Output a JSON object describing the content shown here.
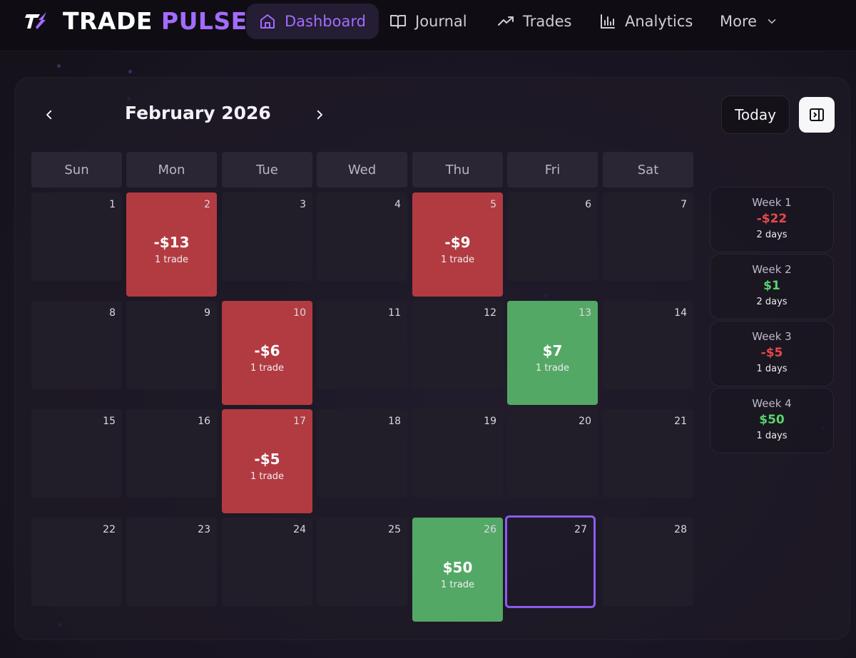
{
  "brand": {
    "word1": "TRADE",
    "word2": "PULSE"
  },
  "nav": {
    "items": [
      {
        "label": "Dashboard",
        "icon": "home-icon",
        "active": true
      },
      {
        "label": "Journal",
        "icon": "book-icon",
        "active": false
      },
      {
        "label": "Trades",
        "icon": "trending-up-icon",
        "active": false
      },
      {
        "label": "Analytics",
        "icon": "bar-chart-icon",
        "active": false
      },
      {
        "label": "More",
        "icon": "chevron-down-icon",
        "active": false
      }
    ]
  },
  "calendar": {
    "month_label": "February 2026",
    "today_label": "Today",
    "weekdays": [
      "Sun",
      "Mon",
      "Tue",
      "Wed",
      "Thu",
      "Fri",
      "Sat"
    ],
    "days": [
      {
        "num": "1"
      },
      {
        "num": "2",
        "pnl": "-$13",
        "trades": "1 trade",
        "status": "loss"
      },
      {
        "num": "3"
      },
      {
        "num": "4"
      },
      {
        "num": "5",
        "pnl": "-$9",
        "trades": "1 trade",
        "status": "loss"
      },
      {
        "num": "6"
      },
      {
        "num": "7"
      },
      {
        "num": "8"
      },
      {
        "num": "9"
      },
      {
        "num": "10",
        "pnl": "-$6",
        "trades": "1 trade",
        "status": "loss"
      },
      {
        "num": "11"
      },
      {
        "num": "12"
      },
      {
        "num": "13",
        "pnl": "$7",
        "trades": "1 trade",
        "status": "win"
      },
      {
        "num": "14"
      },
      {
        "num": "15"
      },
      {
        "num": "16"
      },
      {
        "num": "17",
        "pnl": "-$5",
        "trades": "1 trade",
        "status": "loss"
      },
      {
        "num": "18"
      },
      {
        "num": "19"
      },
      {
        "num": "20"
      },
      {
        "num": "21"
      },
      {
        "num": "22"
      },
      {
        "num": "23"
      },
      {
        "num": "24"
      },
      {
        "num": "25"
      },
      {
        "num": "26",
        "pnl": "$50",
        "trades": "1 trade",
        "status": "win"
      },
      {
        "num": "27",
        "status": "today"
      },
      {
        "num": "28"
      }
    ]
  },
  "weeks": [
    {
      "label": "Week 1",
      "value": "-$22",
      "days": "2 days",
      "sign": "neg"
    },
    {
      "label": "Week 2",
      "value": "$1",
      "days": "2 days",
      "sign": "pos"
    },
    {
      "label": "Week 3",
      "value": "-$5",
      "days": "1 days",
      "sign": "neg"
    },
    {
      "label": "Week 4",
      "value": "$50",
      "days": "1 days",
      "sign": "pos"
    }
  ],
  "colors": {
    "accent": "#a36bff",
    "loss": "#b23b41",
    "win": "#54a866",
    "today_border": "#8c5cf0"
  }
}
